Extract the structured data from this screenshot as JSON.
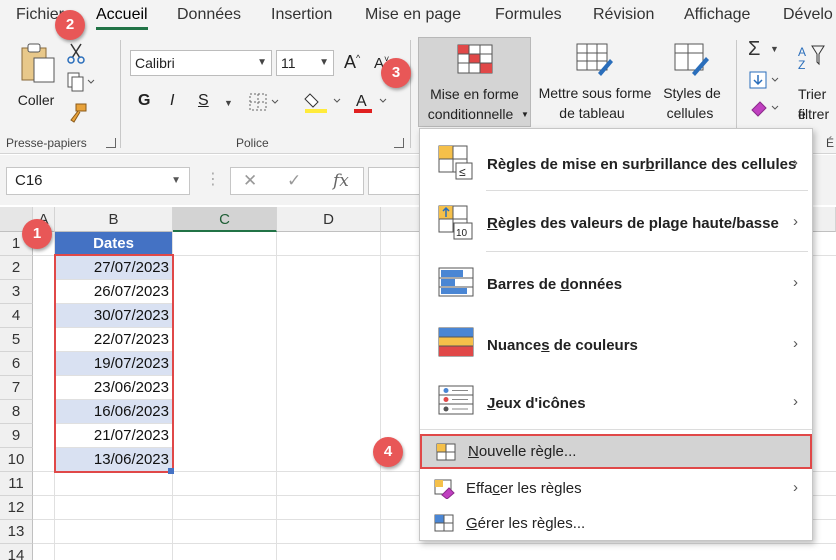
{
  "tabs": [
    "Fichier",
    "Accueil",
    "Données",
    "Insertion",
    "Mise en page",
    "Formules",
    "Révision",
    "Affichage",
    "Dévelo"
  ],
  "active_tab": "Accueil",
  "ribbon": {
    "paste_label": "Coller",
    "group_clipboard": "Presse-papiers",
    "group_font": "Police",
    "font_name": "Calibri",
    "font_size": "11",
    "bold": "G",
    "italic": "I",
    "underline": "S",
    "cf_line1": "Mise en forme",
    "cf_line2": "conditionnelle",
    "table_line1": "Mettre sous forme",
    "table_line2": "de tableau",
    "styles_line1": "Styles de",
    "styles_line2": "cellules",
    "sort_line1": "Trier e",
    "sort_line2": "filtrer",
    "group_edit_partial": "É"
  },
  "formula_bar": {
    "name_box": "C16",
    "fx": "fx"
  },
  "columns": [
    "A",
    "B",
    "C",
    "D"
  ],
  "rows": [
    "1",
    "2",
    "3",
    "4",
    "5",
    "6",
    "7",
    "8",
    "9",
    "10",
    "11",
    "12",
    "13",
    "14"
  ],
  "sheet": {
    "header": "Dates",
    "dates": [
      "27/07/2023",
      "26/07/2023",
      "30/07/2023",
      "22/07/2023",
      "19/07/2023",
      "23/06/2023",
      "16/06/2023",
      "21/07/2023",
      "13/06/2023"
    ]
  },
  "menu": {
    "highlight_rules": {
      "pre": "Règles de mise en sur",
      "u": "b",
      "post": "rillance des cellules"
    },
    "top_bottom": {
      "pre": "",
      "u": "R",
      "post": "ègles des valeurs de plage haute/basse"
    },
    "data_bars": {
      "pre": "Barres de ",
      "u": "d",
      "post": "onnées"
    },
    "color_scales": {
      "pre": "Nuance",
      "u": "s",
      "post": " de couleurs"
    },
    "icon_sets": {
      "pre": "",
      "u": "J",
      "post": "eux d'icônes"
    },
    "new_rule": {
      "pre": "",
      "u": "N",
      "post": "ouvelle règle..."
    },
    "clear_rules": {
      "pre": "Effa",
      "u": "c",
      "post": "er les règles"
    },
    "manage_rules": {
      "pre": "",
      "u": "G",
      "post": "érer les règles..."
    }
  },
  "callouts": [
    "1",
    "2",
    "3",
    "4"
  ],
  "colors": {
    "accent": "#217346",
    "header_fill": "#4472c4",
    "band_fill": "#d9e1f2",
    "callout": "#e85757"
  }
}
